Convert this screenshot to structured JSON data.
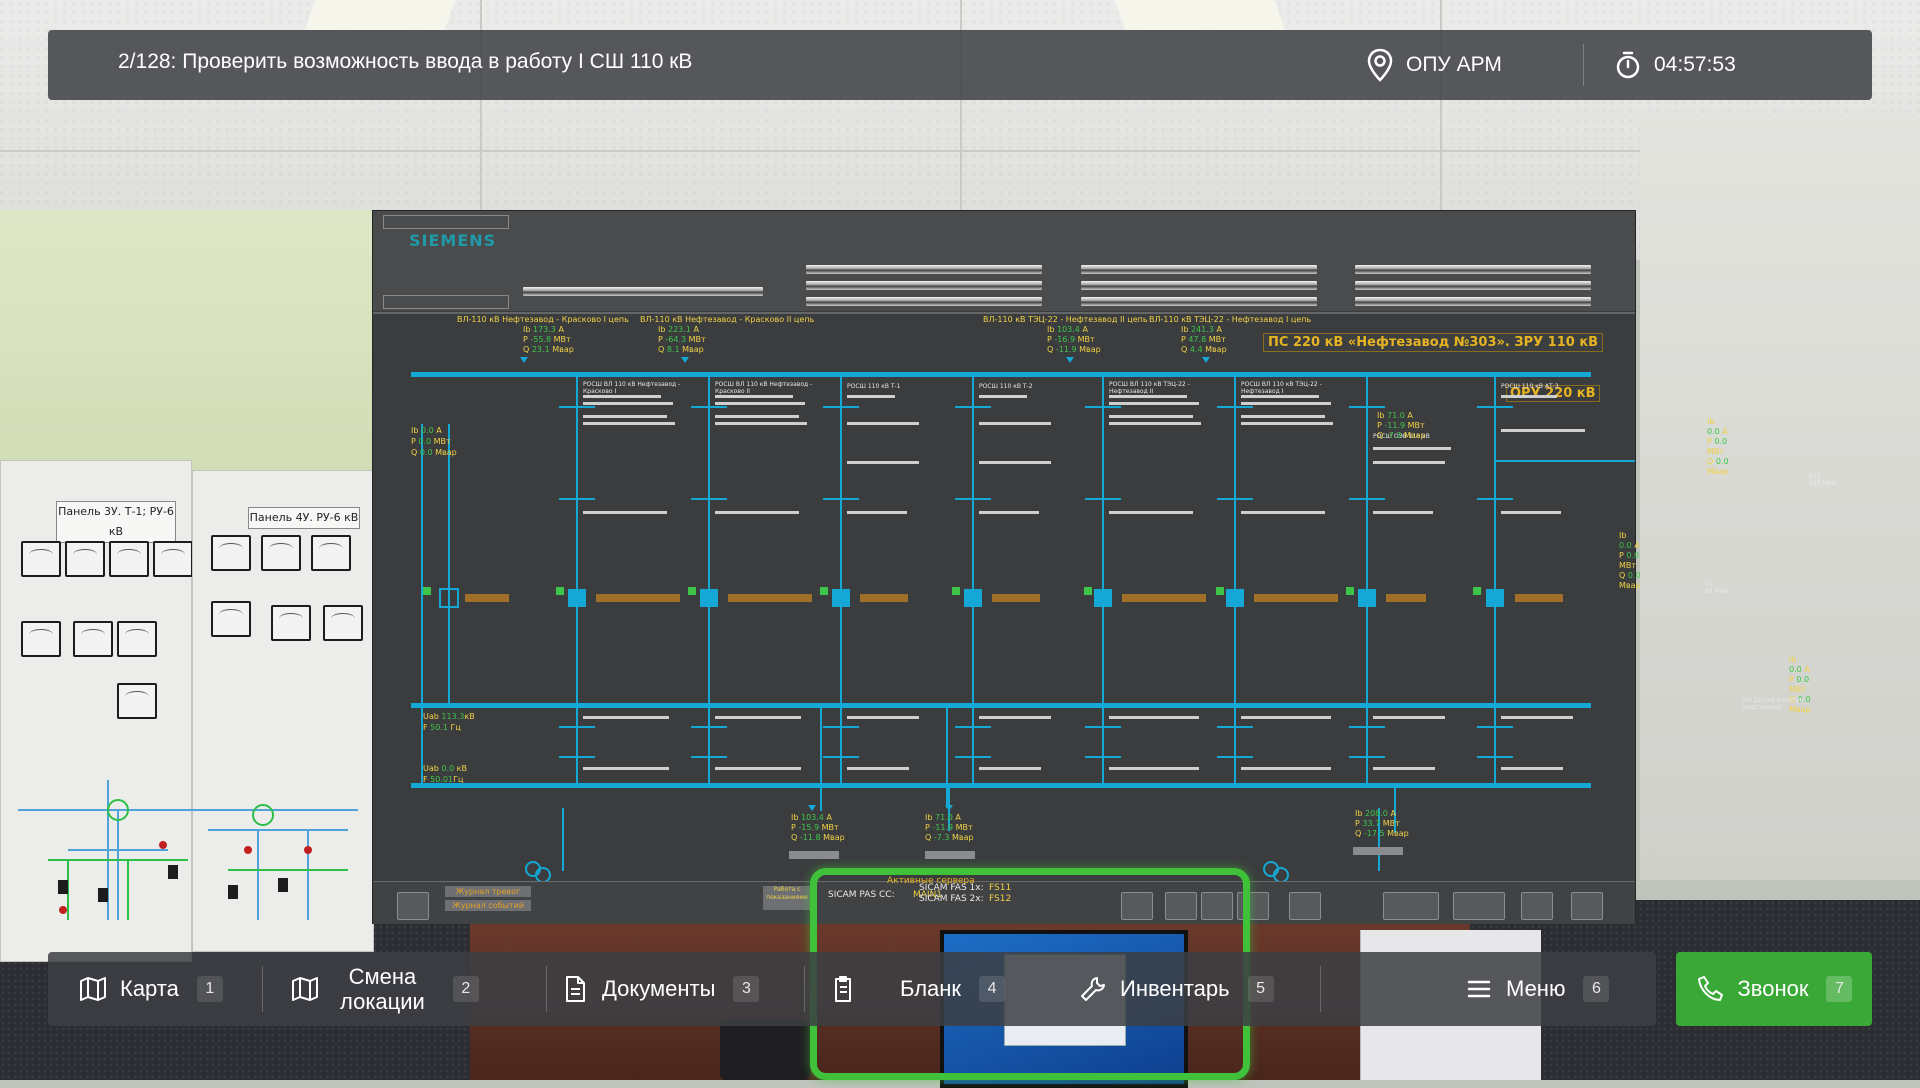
{
  "hud": {
    "task": "2/128: Проверить возможность ввода в работу I СШ 110 кВ",
    "location": "ОПУ АРМ",
    "timer": "04:57:53"
  },
  "nav": [
    {
      "label": "Карта",
      "key": "1",
      "icon": "map-icon"
    },
    {
      "label": "Смена\nлокации",
      "key": "2",
      "icon": "map-swap-icon"
    },
    {
      "label": "Документы",
      "key": "3",
      "icon": "document-icon"
    },
    {
      "label": "Бланк",
      "key": "4",
      "icon": "clipboard-icon"
    },
    {
      "label": "Инвентарь",
      "key": "5",
      "icon": "wrench-icon"
    },
    {
      "label": "Меню",
      "key": "6",
      "icon": "menu-icon"
    }
  ],
  "call": {
    "label": "Звонок",
    "key": "7",
    "icon": "phone-icon"
  },
  "scada": {
    "brand": "SIEMENS",
    "title": "ПС 220 кВ «Нефтезавод №303». ЗРУ 110 кВ",
    "oru_label": "ОРУ 220 кВ",
    "lines": [
      {
        "name": "ВЛ-110 кВ Нефтезавод - Красково I цепь",
        "ib": "173.3",
        "p": "-55.8",
        "q": "23.1"
      },
      {
        "name": "ВЛ-110 кВ Нефтезавод - Красково II цепь",
        "ib": "223.1",
        "p": "-64.3",
        "q": "8.1"
      },
      {
        "name": "ВЛ-110 кВ ТЭЦ-22 - Нефтезавод II цепь",
        "ib": "103.4",
        "p": "-16.9",
        "q": "-11.9"
      },
      {
        "name": "ВЛ-110 кВ ТЭЦ-22 - Нефтезавод I цепь",
        "ib": "241.3",
        "p": "47.8",
        "q": "4.4"
      }
    ],
    "feeders": [
      "РОСШ ВЛ 110 кВ Нефтезавод - Красково I",
      "РОСШ ВЛ 110 кВ Нефтезавод - Красково II",
      "РОСШ 110 кВ Т-1",
      "РОСШ 110 кВ Т-2",
      "РОСШ ВЛ 110 кВ ТЭЦ-22 - Нефтезавод II",
      "РОСШ ВЛ 110 кВ ТЭЦ-22 - Нефтезавод I",
      "РОСШ ОЭВ 110 кВ",
      "РОСШ 110 кВ АТ-3"
    ],
    "units": {
      "a": "А",
      "mw": "МВт",
      "mvar": "Мвар",
      "kv": "кВ",
      "hz": "Гц"
    },
    "bus1": {
      "uab": "113.3",
      "f": "50.1"
    },
    "bus2": {
      "uab": "0.0",
      "f": "50.01"
    },
    "sv_meas": {
      "ib": "0.0",
      "p": "0.0",
      "q": "0.0"
    },
    "oev_meas": {
      "ib": "71.0",
      "p": "-11.9",
      "q": "-7.3"
    },
    "at3_meas": {
      "ib": "0.0",
      "p": "0.0",
      "q": "0.0"
    },
    "t1_meas": {
      "ib": "103.4",
      "p": "-15.9",
      "q": "-11.8"
    },
    "t2_meas": {
      "ib": "71.0",
      "p": "-11.9",
      "q": "-7.3"
    },
    "at3_low_meas": {
      "ib": "208.0",
      "p": "33.7",
      "q": "-17.5"
    },
    "kl_meas": {
      "ib": "0.0",
      "p": "0.0",
      "q": "0.0"
    },
    "at3_label": "АТ3\n125 МВА",
    "t3_label": "Т3\n63 МВА",
    "kl_label": "КЛ 220 кВ Капотня-Нефтезавод",
    "servers_title": "Активные сервера",
    "server_main": "SICAM PAS CC:",
    "server_main_val": "MAIN1",
    "fas1": "SICAM FAS 1x:",
    "fas1_val": "FS11",
    "fas2": "SICAM FAS 2x:",
    "fas2_val": "FS12",
    "btn_journal_alarms": "Журнал тревог",
    "btn_journal_events": "Журнал событий",
    "btn_work": "Работа с\nпоказаниями"
  },
  "panels": {
    "panel1": "Панель 3У. Т-1; РУ-6 кВ",
    "panel2": "Панель 4У. РУ-6 кВ"
  }
}
